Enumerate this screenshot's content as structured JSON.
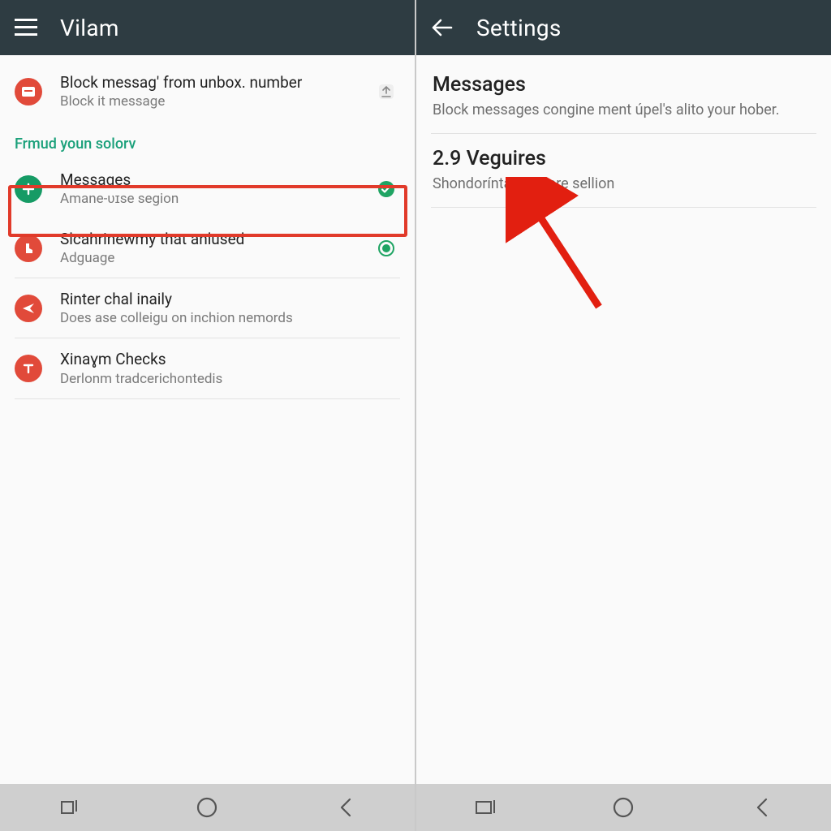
{
  "left": {
    "appbar": {
      "title": "Vilam"
    },
    "row0": {
      "title": "Block messag' from unbox. number",
      "sub": "Block it message"
    },
    "section_header": "Frmud youn solorv",
    "row1": {
      "title": "Messages",
      "sub": "Amane-ʋɪse segion"
    },
    "row2": {
      "title": "Slcahrinewmy that anlused",
      "sub": "Adguage"
    },
    "row3": {
      "title": "Rinter chal inaily",
      "sub": "Does ase colleigu on inchion nemords"
    },
    "row4": {
      "title": "Xinaɣm Checks",
      "sub": "Derlonm tradcerichontedis"
    }
  },
  "right": {
    "appbar": {
      "title": "Settings"
    },
    "block0": {
      "title": "Messages",
      "sub": "Block messages congine ment úpel's alito your hober."
    },
    "block1": {
      "title": "2.9 Veguires",
      "sub": "Shondoríntautal pore sellion"
    }
  }
}
